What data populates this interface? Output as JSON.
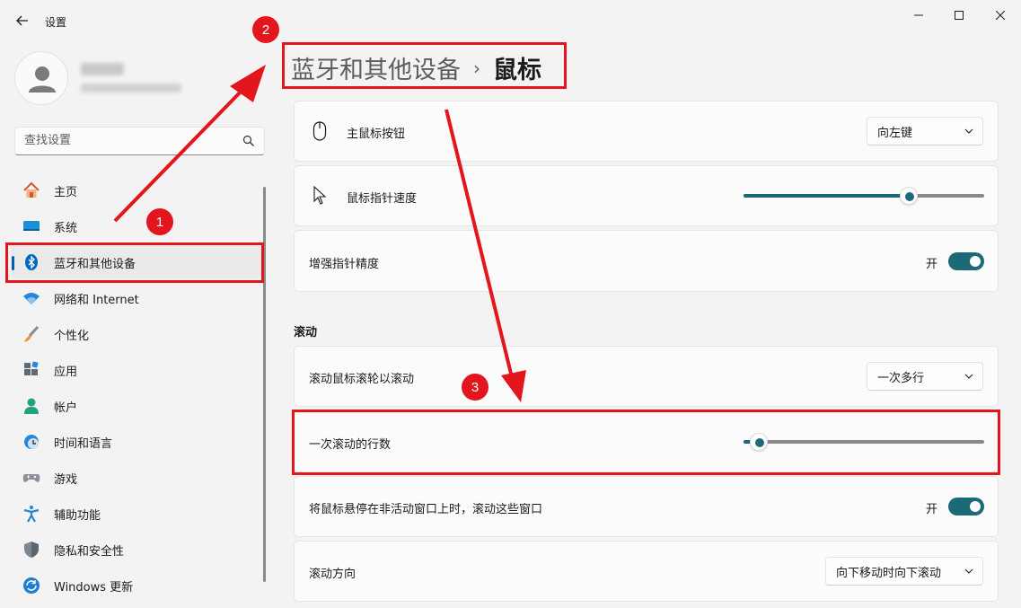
{
  "window": {
    "title": "设置"
  },
  "search": {
    "placeholder": "查找设置"
  },
  "sidebar": {
    "items": [
      {
        "label": "主页",
        "icon": "home-icon"
      },
      {
        "label": "系统",
        "icon": "system-icon"
      },
      {
        "label": "蓝牙和其他设备",
        "icon": "bluetooth-icon",
        "active": true
      },
      {
        "label": "网络和 Internet",
        "icon": "wifi-icon"
      },
      {
        "label": "个性化",
        "icon": "brush-icon"
      },
      {
        "label": "应用",
        "icon": "apps-icon"
      },
      {
        "label": "帐户",
        "icon": "account-icon"
      },
      {
        "label": "时间和语言",
        "icon": "time-language-icon"
      },
      {
        "label": "游戏",
        "icon": "gamepad-icon"
      },
      {
        "label": "辅助功能",
        "icon": "accessibility-icon"
      },
      {
        "label": "隐私和安全性",
        "icon": "shield-icon"
      },
      {
        "label": "Windows 更新",
        "icon": "update-icon"
      }
    ]
  },
  "header": {
    "parent": "蓝牙和其他设备",
    "separator": "›",
    "current": "鼠标"
  },
  "settings": {
    "primary_button": {
      "label": "主鼠标按钮",
      "value": "向左键"
    },
    "pointer_speed": {
      "label": "鼠标指针速度",
      "level": 0.7
    },
    "enhance_precision": {
      "label": "增强指针精度",
      "state": "开",
      "on": true
    },
    "scroll_section": "滚动",
    "scroll_wheel": {
      "label": "滚动鼠标滚轮以滚动",
      "value": "一次多行"
    },
    "lines_per_scroll": {
      "label": "一次滚动的行数",
      "level": 0.03
    },
    "inactive_scroll": {
      "label": "将鼠标悬停在非活动窗口上时，滚动这些窗口",
      "state": "开",
      "on": true
    },
    "scroll_direction": {
      "label": "滚动方向",
      "value": "向下移动时向下滚动"
    }
  },
  "annotations": {
    "badge_1": "1",
    "badge_2": "2",
    "badge_3": "3",
    "color": "#e3161d"
  },
  "colors": {
    "accent": "#1c6a78",
    "bluetooth": "#0067c0"
  }
}
